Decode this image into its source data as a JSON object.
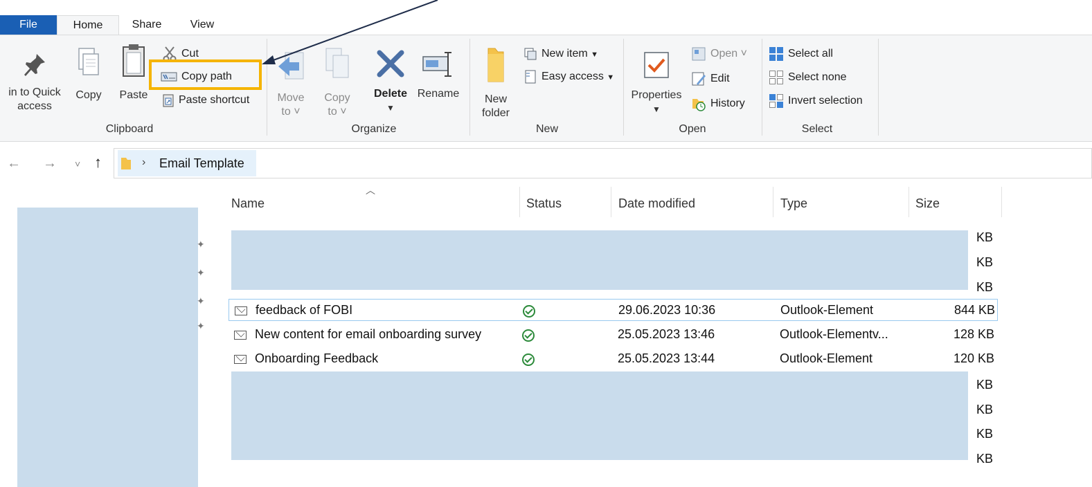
{
  "tabs": {
    "file": "File",
    "home": "Home",
    "share": "Share",
    "view": "View"
  },
  "ribbon": {
    "clipboard": {
      "label": "Clipboard",
      "pin_label_line1": "in to Quick",
      "pin_label_line2": "access",
      "copy": "Copy",
      "paste": "Paste",
      "cut": "Cut",
      "copy_path": "Copy path",
      "paste_shortcut": "Paste shortcut"
    },
    "organize": {
      "label": "Organize",
      "move_to_line1": "Move",
      "move_to_line2": "to",
      "copy_to_line1": "Copy",
      "copy_to_line2": "to",
      "delete": "Delete",
      "rename": "Rename"
    },
    "new": {
      "label": "New",
      "new_folder_line1": "New",
      "new_folder_line2": "folder",
      "new_item": "New item",
      "easy_access": "Easy access"
    },
    "open": {
      "label": "Open",
      "properties": "Properties",
      "open": "Open",
      "edit": "Edit",
      "history": "History"
    },
    "select": {
      "label": "Select",
      "select_all": "Select all",
      "select_none": "Select none",
      "invert_selection": "Invert selection"
    }
  },
  "address": {
    "crumb": "Email Template"
  },
  "columns": {
    "name": "Name",
    "status": "Status",
    "date_modified": "Date modified",
    "type": "Type",
    "size": "Size"
  },
  "kb_fragment": "KB",
  "rows": [
    {
      "name": "feedback of FOBI",
      "date": "29.06.2023 10:36",
      "type": "Outlook-Element",
      "size": "844 KB"
    },
    {
      "name": "New content for email onboarding survey",
      "date": "25.05.2023 13:46",
      "type": "Outlook-Elementv...",
      "size": "128 KB"
    },
    {
      "name": "Onboarding Feedback",
      "date": "25.05.2023 13:44",
      "type": "Outlook-Element",
      "size": "120 KB"
    }
  ],
  "colors": {
    "file_tab": "#1a5fb4",
    "highlight": "#f5b400",
    "redaction": "#c9dcec",
    "selection_border": "#99c9ef",
    "status_ok": "#2c8a3a"
  }
}
